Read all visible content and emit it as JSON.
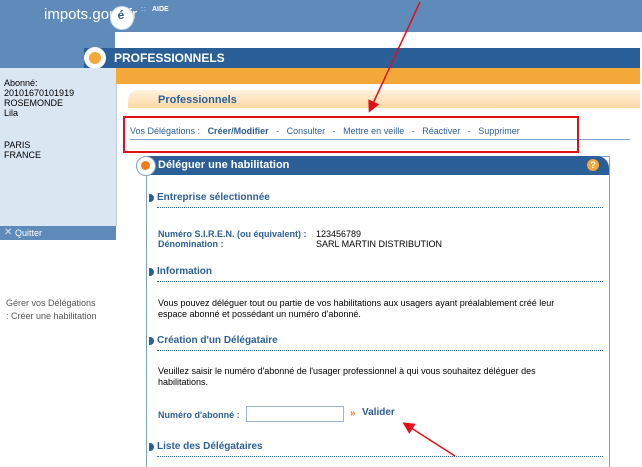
{
  "header": {
    "brand": "impots.gouv.fr",
    "logo_letter": "é",
    "aide_dots": "::",
    "aide": "AIDE"
  },
  "section_bar": {
    "title": "PROFESSIONNELS"
  },
  "user": {
    "abonne_label": "Abonné:",
    "abonne_number": "20101670101919",
    "last_name": "ROSEMONDE",
    "first_name": "Lila",
    "city": "PARIS",
    "country": "FRANCE"
  },
  "quit": {
    "label": "Quitter"
  },
  "section_tab": {
    "label": "Professionnels"
  },
  "nav": {
    "prefix": "Vos Délégations :",
    "items": [
      "Créer/Modifier",
      "Consulter",
      "Mettre en veille",
      "Réactiver",
      "Supprimer"
    ],
    "separator": "-"
  },
  "left_menu": {
    "line1": "Gérer vos Délégations",
    "line2": ": Créer une habilitation"
  },
  "panel": {
    "title": "Déléguer une habilitation",
    "help": "?",
    "sections": {
      "entreprise": {
        "title": "Entreprise sélectionnée",
        "siren_label": "Numéro S.I.R.E.N. (ou équivalent) :",
        "siren_value": "123456789",
        "denomination_label": "Dénomination :",
        "denomination_value": "SARL MARTIN DISTRIBUTION"
      },
      "information": {
        "title": "Information",
        "text_line1": "Vous pouvez déléguer tout ou partie de vos habilitations aux usagers ayant préalablement créé leur",
        "text_line2": "espace abonné et possédant un numéro d'abonné."
      },
      "creation": {
        "title": "Création d'un Délégataire",
        "text_line1": "Veuillez saisir le numéro d'abonné de l'usager professionnel à qui vous souhaitez déléguer des",
        "text_line2": "habilitations.",
        "field_label": "Numéro d'abonné :",
        "field_value": "",
        "submit_arrow": "»",
        "submit_label": "Valider"
      },
      "liste": {
        "title": "Liste des Délégataires"
      }
    }
  },
  "annotation_color": "#e20f1a"
}
